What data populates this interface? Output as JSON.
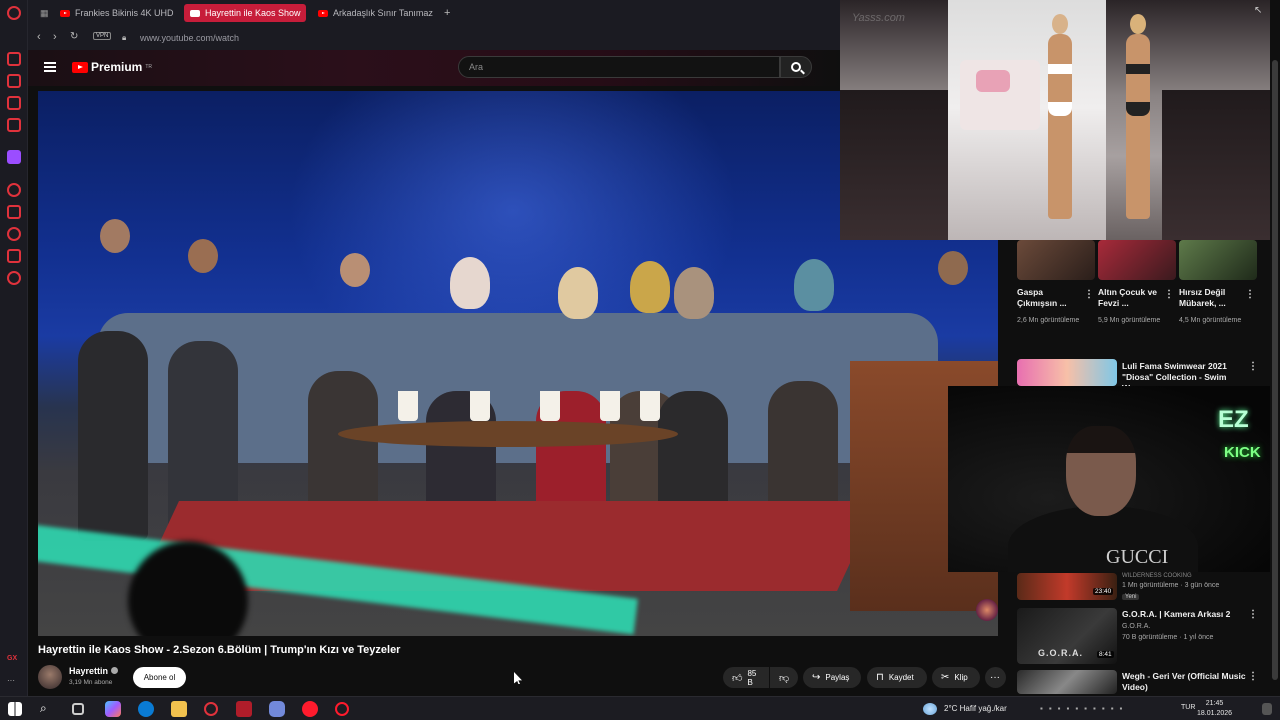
{
  "browser": {
    "tabs": [
      {
        "label": "Frankies Bikinis 4K UHD S"
      },
      {
        "label": "Hayrettin ile Kaos Show"
      },
      {
        "label": "Arkadaşlık Sınır Tanımaz M"
      }
    ],
    "new_tab_label": "+",
    "vpn_label": "VPN",
    "url": "www.youtube.com/watch"
  },
  "youtube": {
    "logo_text": "Premium",
    "logo_region": "TR",
    "search_placeholder": "Ara"
  },
  "video": {
    "title": "Hayrettin ile Kaos Show - 2.Sezon 6.Bölüm | Trump'ın Kızı ve Teyzeler",
    "channel_name": "Hayrettin",
    "subscribers": "3,19 Mn abone",
    "subscribe_label": "Abone ol",
    "likes": "85 B",
    "share_label": "Paylaş",
    "save_label": "Kaydet",
    "clip_label": "Klip"
  },
  "overlay": {
    "runway_watermark": "Yasss.com"
  },
  "recommendations": {
    "top_row": [
      {
        "title": "Gaspa Çıkmışsın ...",
        "meta": "2,6 Mn görüntüleme"
      },
      {
        "title": "Altın Çocuk ve Fevzi ...",
        "meta": "5,9 Mn görüntüleme"
      },
      {
        "title": "Hırsız Değil Mübarek, ...",
        "meta": "4,5 Mn görüntüleme"
      }
    ],
    "list": [
      {
        "title_line1": "Luli Fama Swimwear 2021",
        "title_line2": "\"Diosa\" Collection - Swim Wee..."
      },
      {
        "channel": "WILDERNESS COOKING",
        "meta": "1 Mn görüntüleme · 3 gün önce",
        "tag": "Yeni",
        "duration": "23:40"
      },
      {
        "title": "G.O.R.A. | Kamera Arkası 2",
        "channel": "G.O.R.A.",
        "meta": "70 B görüntüleme · 1 yıl önce",
        "duration": "8:41",
        "thumb_text": "G.O.R.A."
      },
      {
        "title_line1": "Wegh - Geri Ver (Official Music",
        "title_line2": "Video)"
      }
    ]
  },
  "webcam": {
    "neon_line1": "EZ",
    "neon_line2": "KICK",
    "shirt_text": "GUCCI"
  },
  "taskbar": {
    "weather": "2°C  Hafif yağ./kar",
    "lang": "TUR",
    "time": "21:45",
    "date": "18.01.2026"
  },
  "colors": {
    "accent_red": "#ff0000",
    "opera_red": "#e0323c",
    "active_tab": "#c71d3a",
    "yt_background": "#0f0f0f"
  }
}
